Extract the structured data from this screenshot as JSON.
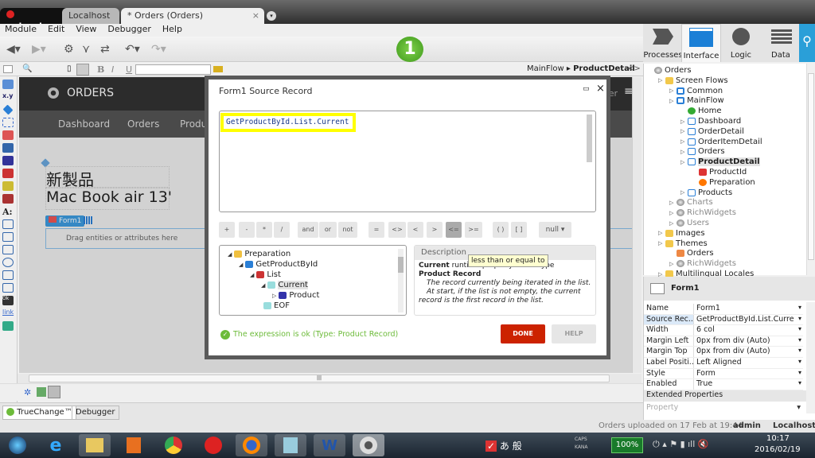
{
  "window": {
    "brand": "outsystems",
    "tabs": [
      "Localhost",
      "* Orders (Orders)"
    ]
  },
  "menu": [
    "Module",
    "Edit",
    "View",
    "Debugger",
    "Help"
  ],
  "publish_badge": "1",
  "big_tabs": [
    "Processes",
    "Interface",
    "Logic",
    "Data"
  ],
  "breadcrumb": {
    "flow": "MainFlow",
    "screen": "ProductDetail",
    "toggle": "<>"
  },
  "canvas": {
    "app_title": "ORDERS",
    "user_fragment": "ser",
    "nav": [
      "Dashboard",
      "Orders",
      "Produc"
    ],
    "heading1": "新製品",
    "heading2": "Mac Book air 13'",
    "form_label": "Form1",
    "drop_hint": "Drag entities or attributes here"
  },
  "dialog": {
    "title": "Form1 Source Record",
    "expression": "GetProductById.List.Current",
    "operators": [
      "+",
      "-",
      "*",
      "/",
      "and",
      "or",
      "not",
      "=",
      "<>",
      "<",
      ">",
      "<=",
      ">=",
      "( )",
      "[ ]"
    ],
    "null_label": "null",
    "tree": [
      {
        "label": "Preparation",
        "level": 0
      },
      {
        "label": "GetProductById",
        "level": 1
      },
      {
        "label": "List",
        "level": 2
      },
      {
        "label": "Current",
        "level": 3
      },
      {
        "label": "Product",
        "level": 4
      },
      {
        "label": "EOF",
        "level": 3
      }
    ],
    "description_tab": "Description",
    "tooltip": "less than or equal to",
    "desc_name": "Current",
    "desc_kind": "runtime property : data type",
    "desc_type": "Product Record",
    "desc_line1": "The record currently being iterated in the list.",
    "desc_line2": "At start, if the list is not empty, the current record is the first record in the list.",
    "status": "The expression is ok (Type: Product Record)",
    "done": "DONE",
    "help": "HELP"
  },
  "tree": [
    {
      "label": "Orders",
      "level": 0,
      "icon": "module"
    },
    {
      "label": "Screen Flows",
      "level": 1,
      "icon": "folder-open"
    },
    {
      "label": "Common",
      "level": 2,
      "icon": "flow"
    },
    {
      "label": "MainFlow",
      "level": 2,
      "icon": "flow"
    },
    {
      "label": "Home",
      "level": 3,
      "icon": "home"
    },
    {
      "label": "Dashboard",
      "level": 3,
      "icon": "screen"
    },
    {
      "label": "OrderDetail",
      "level": 3,
      "icon": "screen"
    },
    {
      "label": "OrderItemDetail",
      "level": 3,
      "icon": "screen"
    },
    {
      "label": "Orders",
      "level": 3,
      "icon": "screen"
    },
    {
      "label": "ProductDetail",
      "level": 3,
      "icon": "screen",
      "selected": true
    },
    {
      "label": "ProductId",
      "level": 4,
      "icon": "input"
    },
    {
      "label": "Preparation",
      "level": 4,
      "icon": "preparation"
    },
    {
      "label": "Products",
      "level": 3,
      "icon": "screen"
    },
    {
      "label": "Charts",
      "level": 2,
      "icon": "module",
      "dim": true
    },
    {
      "label": "RichWidgets",
      "level": 2,
      "icon": "module",
      "dim": true
    },
    {
      "label": "Users",
      "level": 2,
      "icon": "module",
      "dim": true
    },
    {
      "label": "Images",
      "level": 1,
      "icon": "folder"
    },
    {
      "label": "Themes",
      "level": 1,
      "icon": "folder-open"
    },
    {
      "label": "Orders",
      "level": 2,
      "icon": "theme"
    },
    {
      "label": "RichWidgets",
      "level": 2,
      "icon": "module",
      "dim": true
    },
    {
      "label": "Multilingual Locales",
      "level": 1,
      "icon": "folder"
    }
  ],
  "properties": {
    "title": "Form1",
    "rows": [
      {
        "k": "Name",
        "v": "Form1"
      },
      {
        "k": "Source Rec...",
        "v": "GetProductById.List.Curre"
      },
      {
        "k": "Width",
        "v": "6 col"
      },
      {
        "k": "Margin Left",
        "v": "0px from div (Auto)"
      },
      {
        "k": "Margin Top",
        "v": "0px from div (Auto)"
      },
      {
        "k": "Label Positi...",
        "v": "Left Aligned"
      },
      {
        "k": "Style",
        "v": "Form"
      },
      {
        "k": "Enabled",
        "v": "True"
      }
    ],
    "extended": "Extended Properties",
    "property_placeholder": "Property"
  },
  "bottom_tabs": [
    "TrueChange™",
    "Debugger"
  ],
  "status": {
    "message": "Orders uploaded on 17 Feb at 19:44",
    "user": "admin",
    "server": "Localhost"
  },
  "taskbar": {
    "battery": "100%",
    "time": "10:17",
    "date": "2016/02/19",
    "ime": [
      "あ",
      "般"
    ],
    "caps": "CAPS",
    "kana": "KANA"
  },
  "colors": {
    "accent": "#2a9fd8",
    "done": "#cc2200",
    "ok": "#6dbb3a",
    "highlight": "#ffff00"
  }
}
